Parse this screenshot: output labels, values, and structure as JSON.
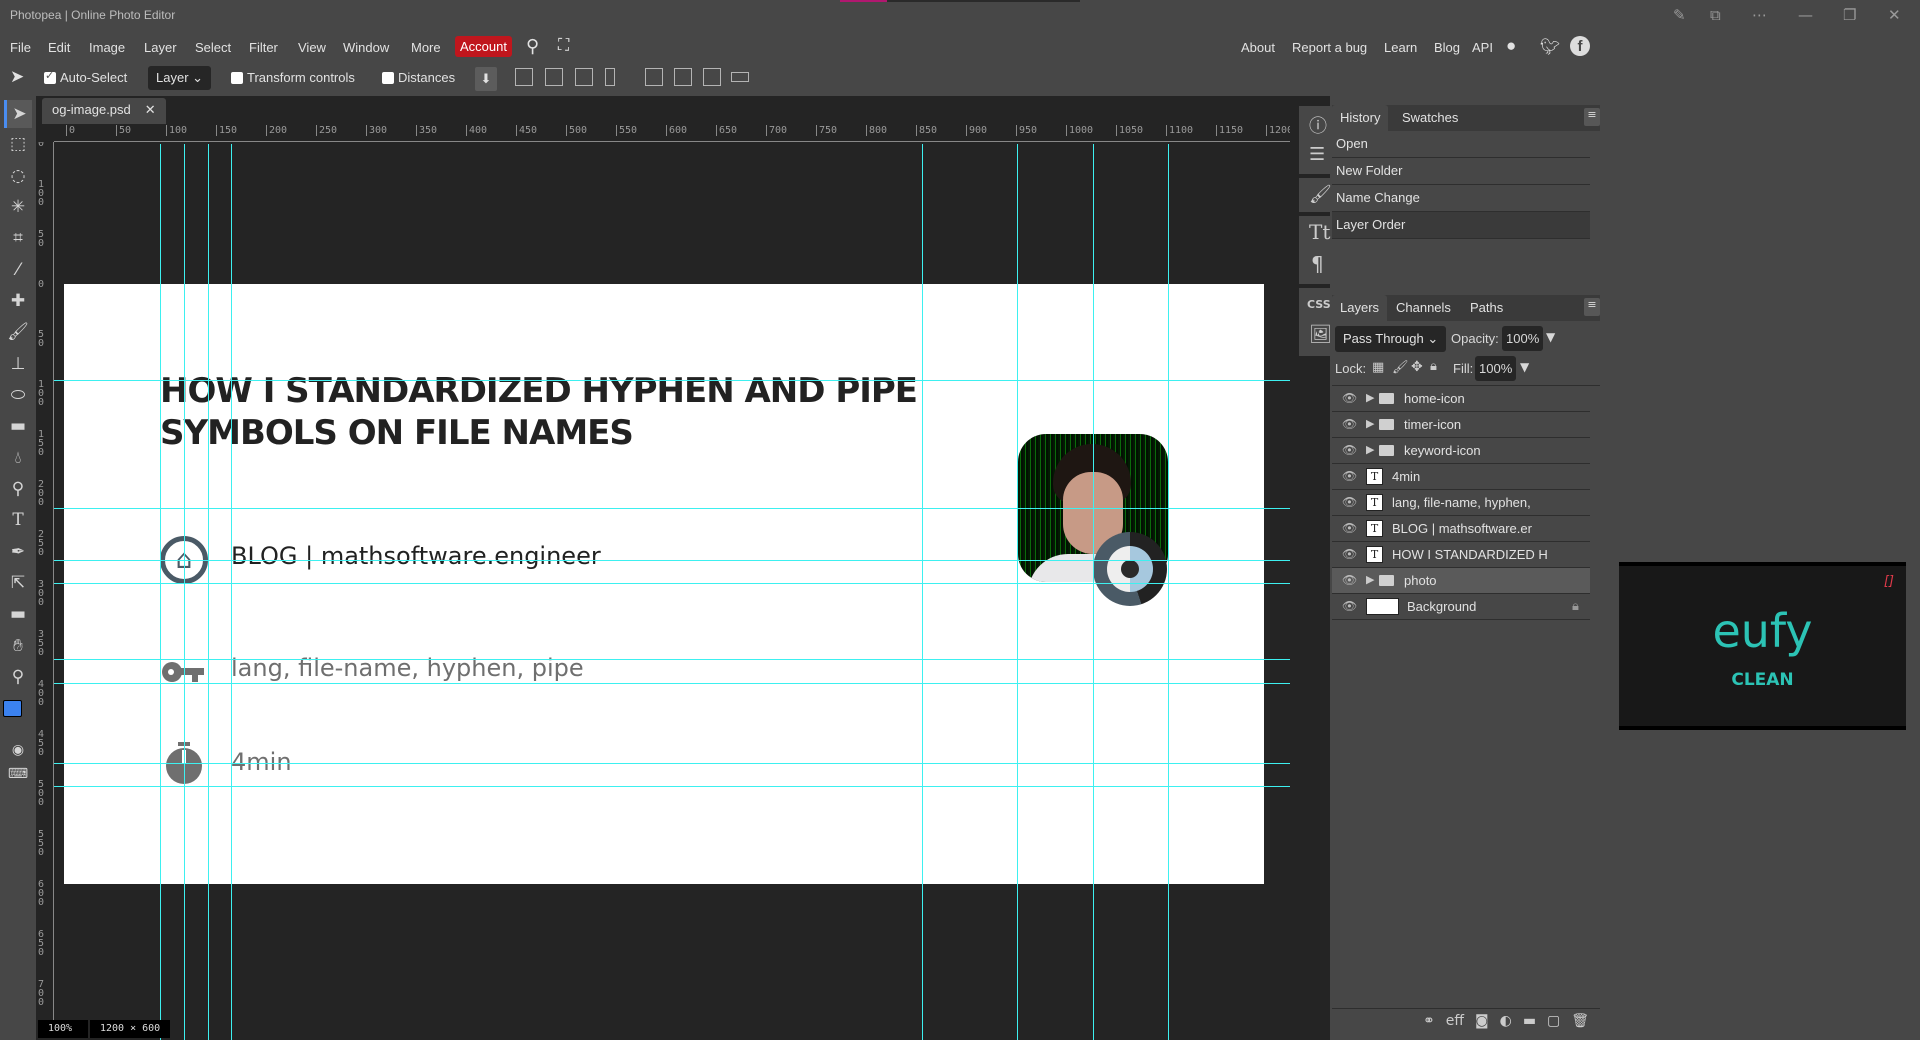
{
  "window": {
    "title": "Photopea | Online Photo Editor",
    "controls": [
      "file-draw-icon",
      "search-page-icon",
      "more-icon",
      "minimize-icon",
      "restore-icon",
      "close-icon"
    ]
  },
  "menubar": {
    "items": [
      "File",
      "Edit",
      "Image",
      "Layer",
      "Select",
      "Filter",
      "View",
      "Window",
      "More"
    ],
    "account": "Account",
    "right_links": [
      "About",
      "Report a bug",
      "Learn",
      "Blog",
      "API"
    ],
    "social": [
      "reddit-icon",
      "twitter-icon",
      "facebook-icon"
    ],
    "accent_color": "#c0161d"
  },
  "options": {
    "auto_select_label": "Auto-Select",
    "auto_select_checked": true,
    "target_select": "Layer",
    "transform_controls_label": "Transform controls",
    "transform_controls_checked": false,
    "distances_label": "Distances",
    "distances_checked": false
  },
  "tools": [
    "move",
    "marquee",
    "lasso",
    "magic-wand",
    "crop",
    "eyedropper",
    "healing",
    "brush",
    "stamp",
    "eraser",
    "gradient",
    "blur",
    "dodge",
    "type",
    "pen",
    "path-select",
    "shape",
    "hand",
    "zoom"
  ],
  "colors": {
    "foreground": "#3b82f0",
    "background": "#ffffff"
  },
  "document": {
    "tab_name": "og-image.psd",
    "zoom": "100%",
    "size": "1200 × 600",
    "ruler_h": [
      "0",
      "50",
      "100",
      "150",
      "200",
      "250",
      "300",
      "350",
      "400",
      "450",
      "500",
      "550",
      "600",
      "650",
      "700",
      "750",
      "800",
      "850",
      "900",
      "950",
      "1000",
      "1050",
      "1100",
      "1150",
      "1200"
    ],
    "ruler_v": [
      "50",
      "100",
      "50",
      "0",
      "50",
      "100",
      "150",
      "200",
      "250",
      "300",
      "350",
      "400",
      "450",
      "500",
      "550",
      "600",
      "650",
      "700"
    ]
  },
  "canvas": {
    "headline": [
      "HOW I STANDARDIZED HYPHEN AND PIPE",
      "SYMBOLS ON FILE NAMES"
    ],
    "blog_line": "BLOG | mathsoftware.engineer",
    "keywords_line": "lang, file-name, hyphen, pipe",
    "time_line": "4min",
    "text_dark": "#222222",
    "text_gray": "#6f6f6f",
    "icon_color": "#4a5a66"
  },
  "history": {
    "tabs": [
      "History",
      "Swatches"
    ],
    "items": [
      "Open",
      "New Folder",
      "Name Change",
      "Layer Order"
    ],
    "selected": "Layer Order"
  },
  "layers": {
    "tabs": [
      "Layers",
      "Channels",
      "Paths"
    ],
    "blend_mode": "Pass Through",
    "opacity_label": "Opacity:",
    "opacity": "100%",
    "lock_label": "Lock:",
    "fill_label": "Fill:",
    "fill": "100%",
    "items": [
      {
        "name": "home-icon",
        "type": "folder"
      },
      {
        "name": "timer-icon",
        "type": "folder"
      },
      {
        "name": "keyword-icon",
        "type": "folder"
      },
      {
        "name": "4min",
        "type": "text"
      },
      {
        "name": "lang, file-name, hyphen,",
        "type": "text"
      },
      {
        "name": "BLOG | mathsoftware.er",
        "type": "text"
      },
      {
        "name": "HOW I STANDARDIZED H",
        "type": "text"
      },
      {
        "name": "photo",
        "type": "folder",
        "selected": true
      },
      {
        "name": "Background",
        "type": "background",
        "locked": true
      }
    ],
    "footer_icons": [
      "link-icon",
      "effects-icon",
      "mask-icon",
      "adjustment-icon",
      "folder-icon",
      "new-layer-icon",
      "trash-icon"
    ]
  },
  "side_icons": [
    "info-icon",
    "adjustments-icon",
    "brush-settings-icon",
    "character-icon",
    "paragraph-icon",
    "css-icon",
    "image-icon"
  ],
  "ad": {
    "brand": "eufy",
    "sub": "CLEAN",
    "color": "#2cc3b5"
  }
}
